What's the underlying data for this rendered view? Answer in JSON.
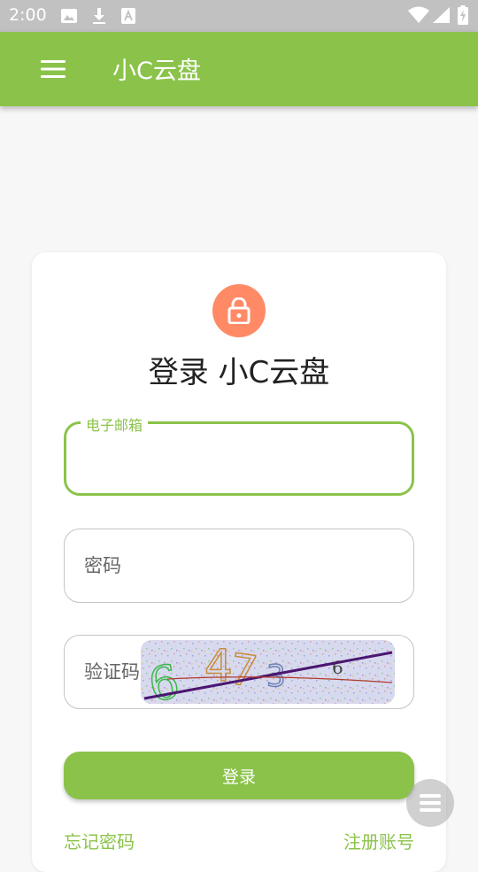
{
  "status_bar": {
    "time": "2:00",
    "icons": [
      "image-icon",
      "download-icon",
      "text-icon",
      "wifi-icon",
      "signal-icon",
      "battery-icon"
    ]
  },
  "app_bar": {
    "title": "小C云盘",
    "menu_icon": "menu-icon",
    "background_color": "#8bc34a"
  },
  "login": {
    "icon": "lock-icon",
    "icon_color": "#ff8a65",
    "title": "登录 小C云盘",
    "email": {
      "label": "电子邮箱",
      "value": ""
    },
    "password": {
      "placeholder": "密码",
      "value": ""
    },
    "captcha": {
      "placeholder": "验证码",
      "value": "",
      "image_text": "6473 6"
    },
    "login_button": "登录",
    "forgot_password": "忘记密码",
    "register": "注册账号"
  },
  "fab": {
    "icon": "menu-lines-icon"
  },
  "colors": {
    "accent": "#8bc34a",
    "lock": "#ff8a65"
  }
}
